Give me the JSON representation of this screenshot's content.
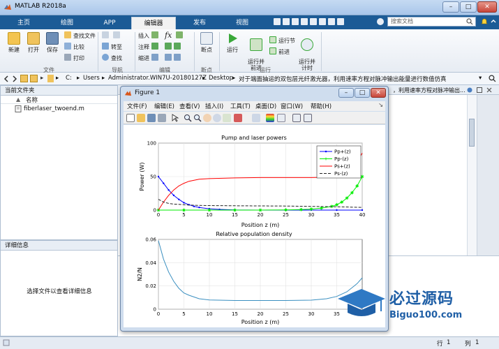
{
  "window": {
    "title": "MATLAB R2018a",
    "controls": [
      "–",
      "□",
      "✕"
    ]
  },
  "ribbon_tabs": [
    "主页",
    "绘图",
    "APP",
    "编辑器",
    "发布",
    "视图"
  ],
  "active_tab": "编辑器",
  "search": {
    "placeholder": "搜索文档"
  },
  "ribbon": {
    "file": {
      "label": "文件",
      "new": "新建",
      "open": "打开",
      "save": "保存",
      "find_files": "查找文件",
      "compare": "比较",
      "print": "打印"
    },
    "navigate": {
      "label": "导航",
      "goto": "转至",
      "find": "查找"
    },
    "edit": {
      "label": "编辑",
      "insert": "插入",
      "comment": "注释",
      "indent": "缩进",
      "fx": "fx"
    },
    "breakpoints": {
      "label": "断点",
      "breakpoints": "断点"
    },
    "run": {
      "label": "运行",
      "run": "运行",
      "run_and_advance": "运行并\n前进",
      "run_section": "运行节",
      "advance": "前进",
      "run_and_time": "运行并\n计时"
    }
  },
  "address": {
    "path": [
      "C:",
      "Users",
      "Administrator.WIN7U-20180127Z",
      "Desktop",
      "对于端面抽运的双包层光纤激光器，利用速率方程对脉冲输出能量进行数值仿真"
    ],
    "right_path": "，利用速率方程对脉冲输出..."
  },
  "current_folder": {
    "header": "当前文件夹",
    "column_name": "名称",
    "sort_indicator": "▲",
    "files": [
      {
        "name": "fiberlaser_twoend.m"
      }
    ]
  },
  "details": {
    "header": "详细信息",
    "message": "选择文件以查看详细信息"
  },
  "statusbar": {
    "row_label": "行",
    "row_value": "1",
    "col_label": "列",
    "col_value": "1"
  },
  "watermark": {
    "title": "必过源码",
    "url": "Biguo100.com"
  },
  "figure": {
    "title": "Figure 1",
    "menu": [
      "文件(F)",
      "编辑(E)",
      "查看(V)",
      "插入(I)",
      "工具(T)",
      "桌面(D)",
      "窗口(W)",
      "帮助(H)"
    ],
    "toolbar_icons": [
      "new-figure-icon",
      "open-icon",
      "save-icon",
      "print-icon",
      "pointer-icon",
      "zoom-in-icon",
      "zoom-out-icon",
      "pan-icon",
      "rotate-icon",
      "data-cursor-icon",
      "brush-icon",
      "link-icon",
      "colorbar-icon",
      "legend-icon",
      "hide-tools-icon",
      "show-tools-icon"
    ]
  },
  "chart_data": [
    {
      "type": "line",
      "title": "Pump and laser powers",
      "xlabel": "Position z (m)",
      "ylabel": "Power (W)",
      "xlim": [
        0,
        40
      ],
      "ylim": [
        0,
        100
      ],
      "xticks": [
        0,
        5,
        10,
        15,
        20,
        25,
        30,
        35,
        40
      ],
      "yticks": [
        0,
        50,
        100
      ],
      "grid": true,
      "legend": "top-right",
      "series": [
        {
          "name": "Pp+(z)",
          "color": "#0000ff",
          "marker": "dot",
          "style": "solid",
          "x": [
            0,
            1,
            2,
            3,
            4,
            5,
            6,
            7,
            8,
            10,
            12,
            15,
            20,
            25,
            30,
            35,
            40
          ],
          "y": [
            50,
            40,
            30,
            22,
            16,
            11,
            8,
            5.5,
            4,
            2,
            1,
            0.3,
            0,
            0,
            0,
            0,
            0
          ]
        },
        {
          "name": "Pp-(z)",
          "color": "#00ee00",
          "marker": "star",
          "style": "solid",
          "x": [
            0,
            5,
            10,
            15,
            20,
            25,
            28,
            30,
            32,
            34,
            35,
            36,
            37,
            38,
            39,
            40
          ],
          "y": [
            0,
            0,
            0,
            0,
            0,
            0.3,
            0.8,
            1.5,
            3,
            5.5,
            8,
            12,
            18,
            26,
            36,
            50
          ]
        },
        {
          "name": "Ps+(z)",
          "color": "#ff0000",
          "marker": "none",
          "style": "solid",
          "x": [
            0,
            1,
            2,
            3,
            4,
            5,
            6,
            8,
            10,
            15,
            20,
            25,
            30,
            33,
            35,
            36,
            37,
            38,
            39,
            40
          ],
          "y": [
            0,
            12,
            22,
            30,
            36,
            40,
            43,
            46,
            47,
            48,
            48.5,
            48.5,
            48.5,
            49,
            50,
            52,
            55,
            62,
            72,
            85
          ]
        },
        {
          "name": "Ps-(z)",
          "color": "#222222",
          "marker": "none",
          "style": "dashed",
          "x": [
            0,
            1,
            2,
            3,
            4,
            5,
            6,
            8,
            10,
            15,
            20,
            25,
            30,
            35,
            40
          ],
          "y": [
            16,
            12,
            10,
            9,
            8.5,
            8,
            7.5,
            7,
            6.8,
            6.5,
            6.3,
            6,
            5.5,
            5,
            4
          ]
        }
      ]
    },
    {
      "type": "line",
      "title": "Relative population density",
      "xlabel": "Position z (m)",
      "ylabel": "N2/N",
      "xlim": [
        0,
        40
      ],
      "ylim": [
        0,
        0.06
      ],
      "xticks": [
        0,
        5,
        10,
        15,
        20,
        25,
        30,
        35
      ],
      "yticks": [
        0,
        0.02,
        0.04,
        0.06
      ],
      "grid": true,
      "series": [
        {
          "color": "#3a8fc0",
          "style": "solid",
          "x": [
            0,
            1,
            2,
            3,
            4,
            5,
            6,
            8,
            10,
            15,
            20,
            25,
            30,
            33,
            35,
            37,
            39,
            40
          ],
          "y": [
            0.059,
            0.043,
            0.032,
            0.024,
            0.018,
            0.014,
            0.012,
            0.009,
            0.008,
            0.0075,
            0.0075,
            0.0075,
            0.0078,
            0.009,
            0.011,
            0.015,
            0.022,
            0.027
          ]
        }
      ]
    }
  ]
}
